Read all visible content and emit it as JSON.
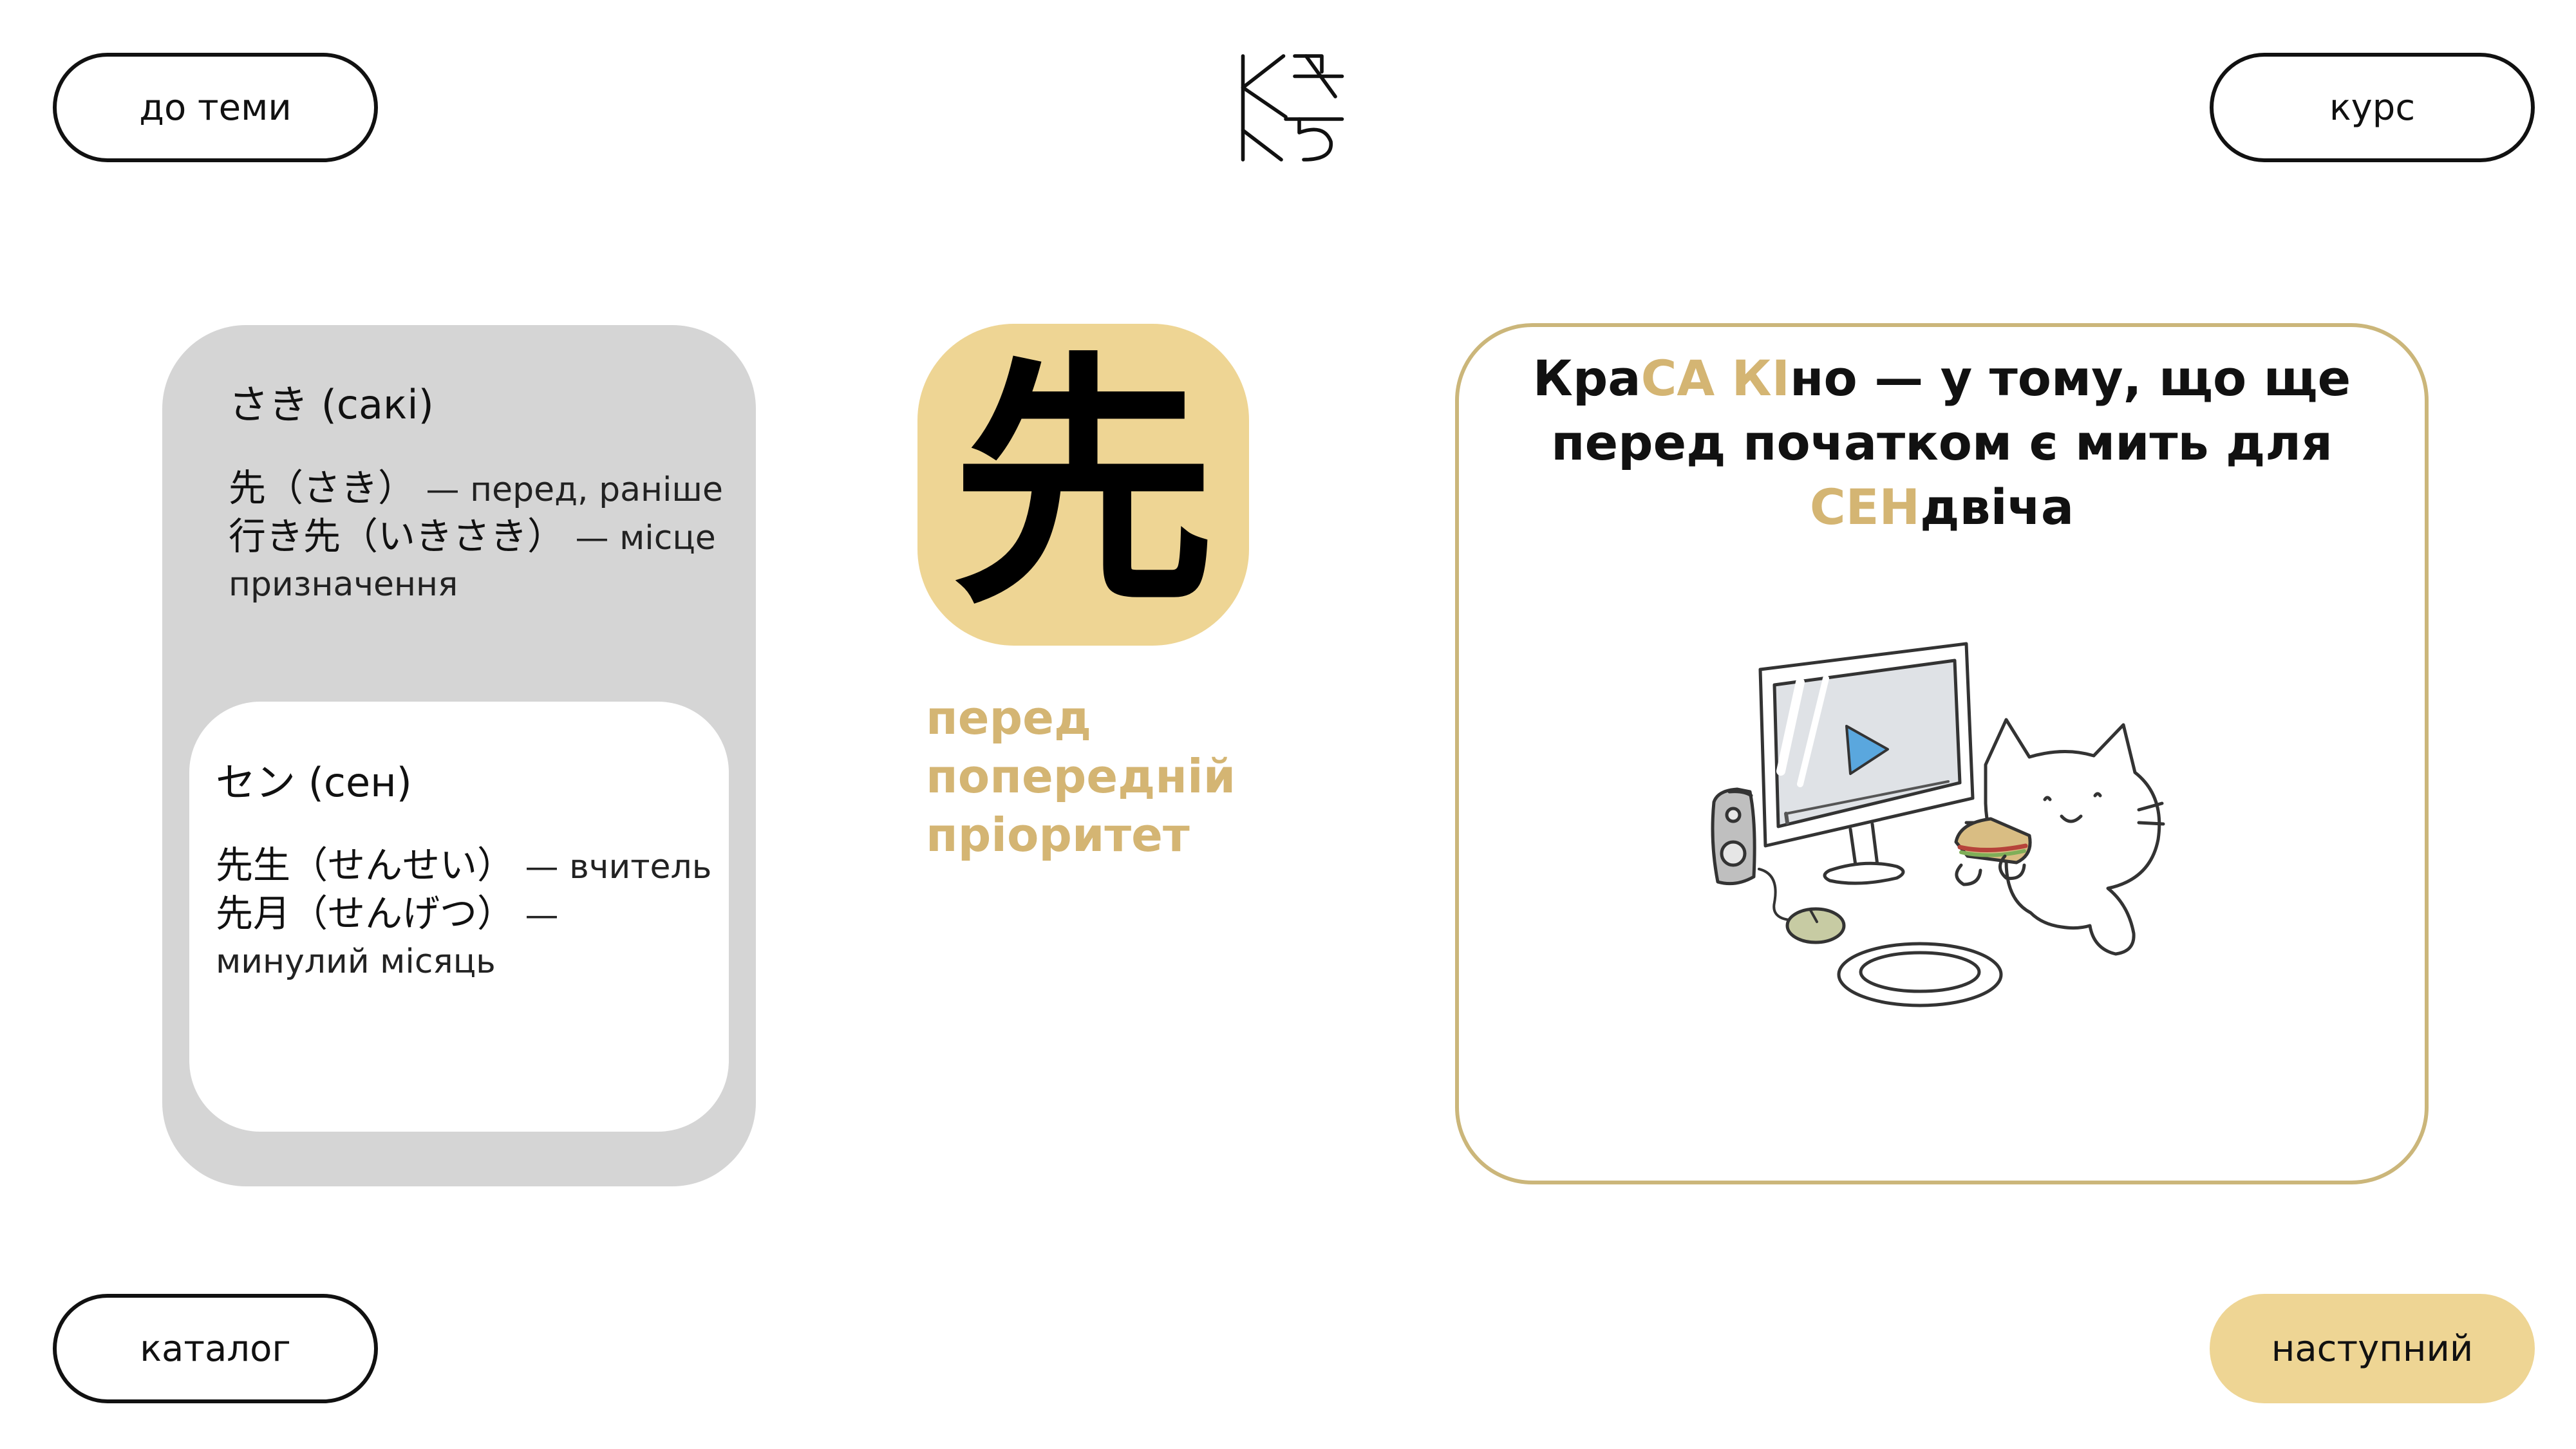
{
  "nav": {
    "back_label": "до теми",
    "course_label": "курс",
    "catalog_label": "каталог",
    "next_label": "наступний"
  },
  "kanji": {
    "character": "先",
    "meanings": [
      "перед",
      "попередній",
      "пріоритет"
    ]
  },
  "kun_reading": {
    "title": "さき (сакі)",
    "examples": [
      {
        "word": "先（さき）",
        "gloss": " — перед, раніше"
      },
      {
        "word": "行き先（いきさき）",
        "gloss": " — місце призначення"
      }
    ]
  },
  "on_reading": {
    "title": "セン (сен)",
    "examples": [
      {
        "word": "先生（せんせい）",
        "gloss": " — вчитель"
      },
      {
        "word": "先月（せんげつ）",
        "gloss": " — минулий місяць"
      }
    ]
  },
  "mnemonic": {
    "parts": [
      {
        "text": "Кра",
        "highlight": false
      },
      {
        "text": "СА КІ",
        "highlight": true
      },
      {
        "text": "но — у тому, що ще перед початком є мить для ",
        "highlight": false
      },
      {
        "text": "СЕН",
        "highlight": true
      },
      {
        "text": "двіча",
        "highlight": false
      }
    ]
  },
  "colors": {
    "accent": "#eed594",
    "accent_text": "#d4b573",
    "card_gray": "#d5d5d5",
    "card_border": "#cbb67a"
  },
  "icons": {
    "logo": "kaku-logo",
    "illustration": "cat-eating-sandwich-at-computer"
  }
}
